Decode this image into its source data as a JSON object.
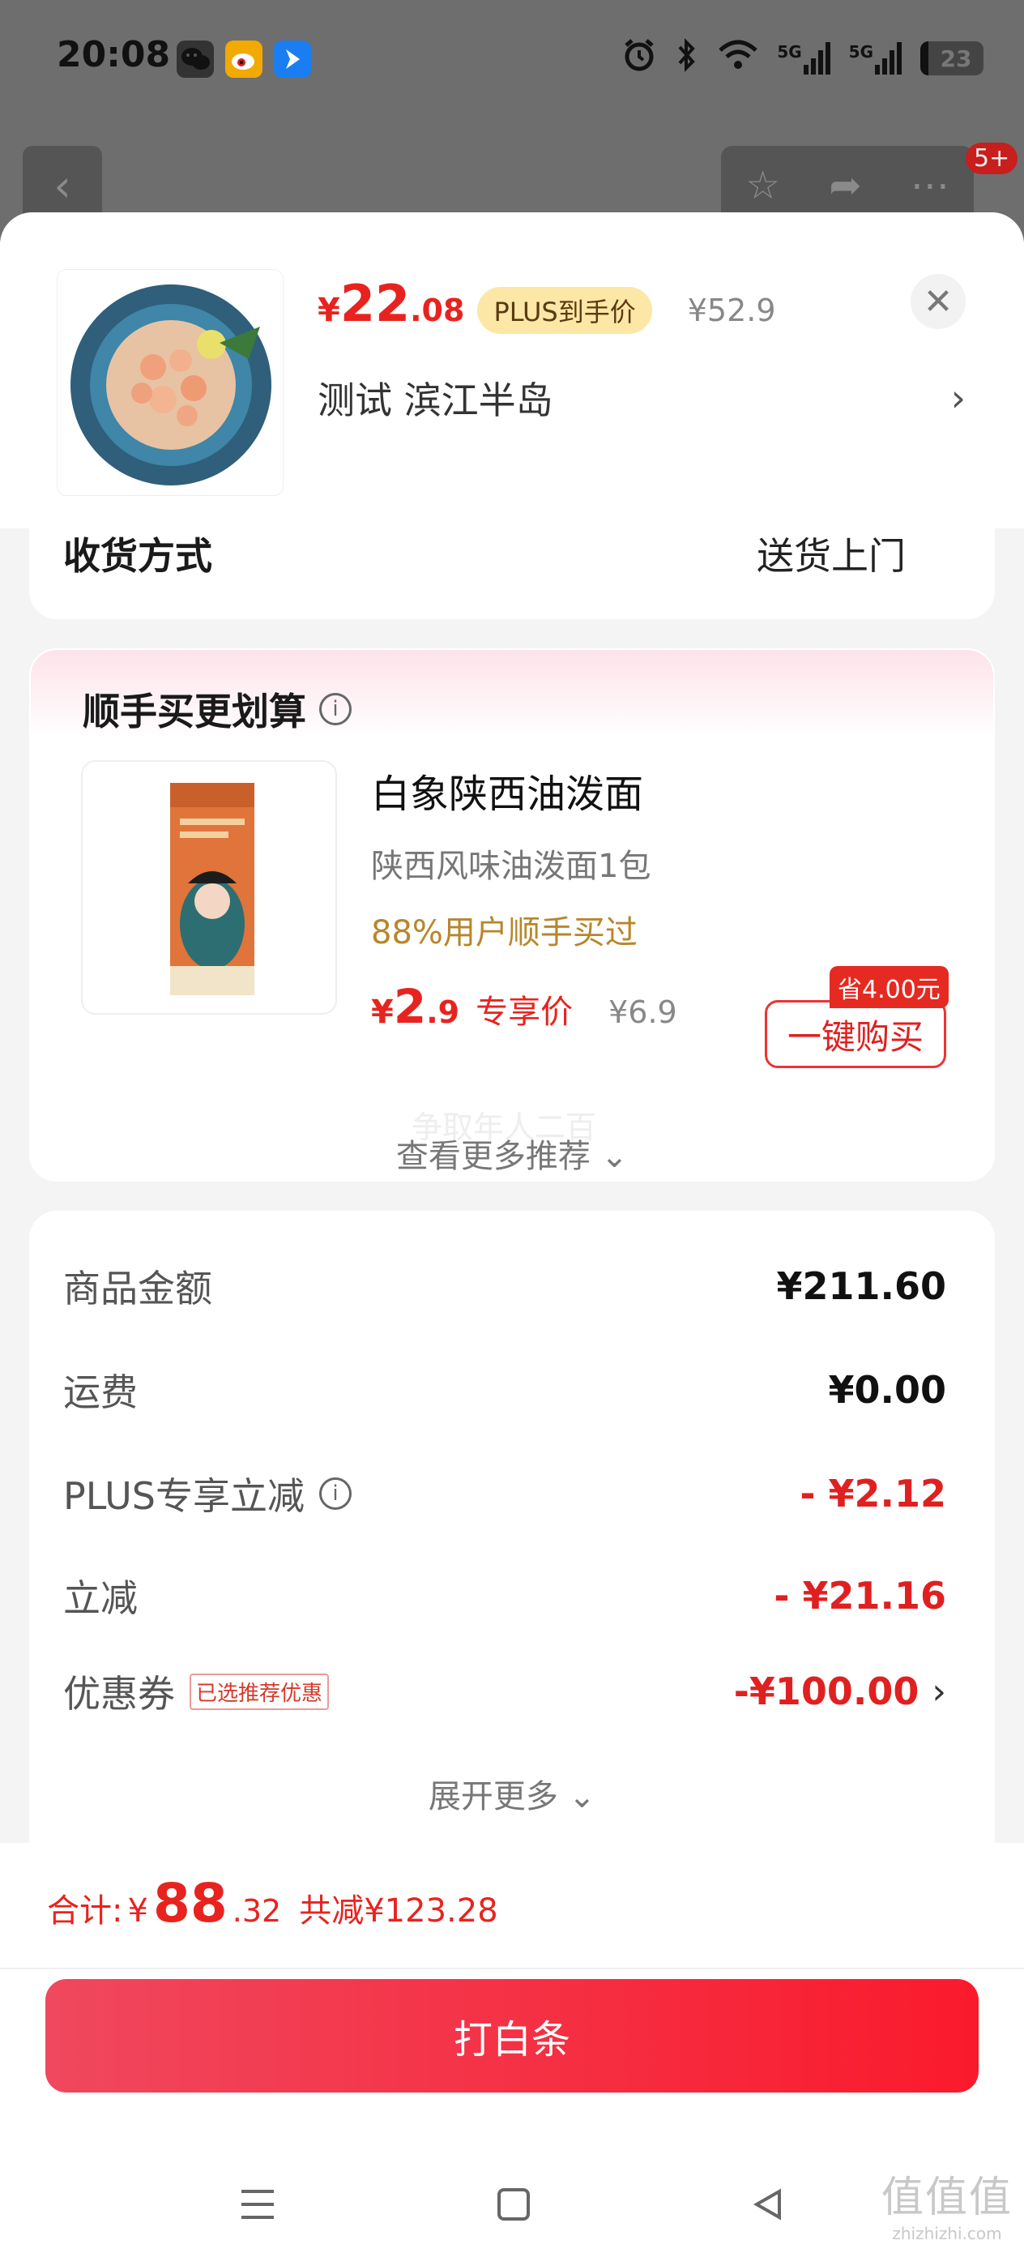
{
  "status_bar": {
    "time": "20:08",
    "battery": "23",
    "signal_labels": [
      "5G",
      "5G"
    ]
  },
  "background_page": {
    "badge": "5+"
  },
  "product": {
    "price_symbol": "¥",
    "price_int": "22",
    "price_dec": ".08",
    "plus_tag": "PLUS到手价",
    "original_price": "¥52.9",
    "address": "测试  滨江半岛",
    "address_chevron": "›",
    "close": "✕"
  },
  "delivery": {
    "label": "收货方式",
    "value": "送货上门"
  },
  "recommend": {
    "title": "顺手买更划算",
    "info_icon": "i",
    "item": {
      "name": "白象陕西油泼面",
      "desc": "陕西风味油泼面1包",
      "social_proof": "88%用户顺手买过",
      "price_symbol": "¥",
      "price_int": "2",
      "price_dec": ".9",
      "price_label": "专享价",
      "original_price": "¥6.9",
      "save_badge": "省4.00元",
      "buy_label": "一键购买",
      "ghost_text": "争取年人二百"
    },
    "more_label": "查看更多推荐 ⌄"
  },
  "fees": {
    "rows": [
      {
        "label": "商品金额",
        "value": "¥211.60"
      },
      {
        "label": "运费",
        "value": "¥0.00"
      },
      {
        "label": "PLUS专享立减",
        "value": "- ¥2.12"
      },
      {
        "label": "立减",
        "value": "- ¥21.16"
      },
      {
        "label": "优惠券",
        "tag": "已选推荐优惠",
        "value": "-¥100.00"
      }
    ],
    "expand_label": "展开更多 ⌄"
  },
  "footer": {
    "total_label": "合计: ",
    "total_symbol": "¥",
    "total_int": "88",
    "total_dec": ".32",
    "saved": "共减¥123.28",
    "pay_label": "打白条"
  },
  "watermark": {
    "line1": "值值值",
    "line2": "zhizhizhi.com"
  },
  "colors": {
    "accent_red": "#e8231f",
    "plus_gold": "#fde7a6",
    "social_gold": "#b8862b"
  }
}
